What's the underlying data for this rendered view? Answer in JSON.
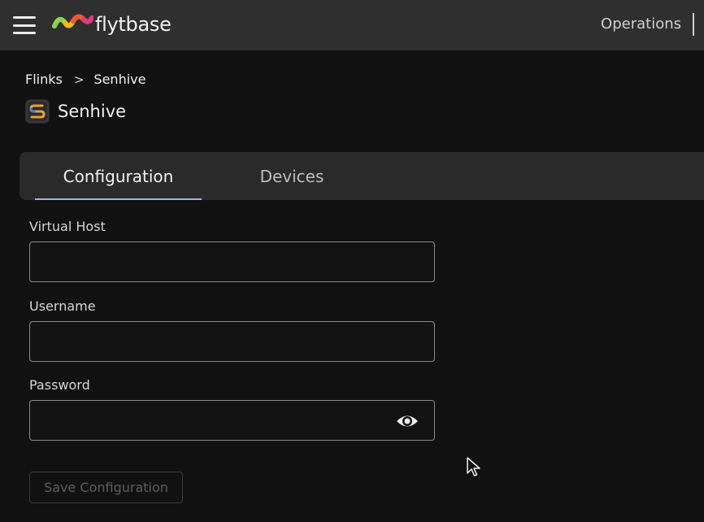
{
  "header": {
    "brand_name": "flytbase",
    "right_menu_label": "Operations"
  },
  "breadcrumb": {
    "root": "Flinks",
    "separator": ">",
    "current": "Senhive"
  },
  "page": {
    "title": "Senhive"
  },
  "tabs": [
    {
      "label": "Configuration",
      "active": true
    },
    {
      "label": "Devices",
      "active": false
    }
  ],
  "form": {
    "virtual_host": {
      "label": "Virtual Host",
      "value": ""
    },
    "username": {
      "label": "Username",
      "value": ""
    },
    "password": {
      "label": "Password",
      "value": ""
    },
    "save_label": "Save Configuration"
  },
  "colors": {
    "accent": "#9db4ea",
    "topbar": "#2f2f2f",
    "background": "#111111"
  },
  "icons": [
    "hamburger-icon",
    "flytbase-logo-icon",
    "senhive-logo-icon",
    "eye-icon",
    "chevron-right-icon",
    "mouse-cursor-icon"
  ]
}
